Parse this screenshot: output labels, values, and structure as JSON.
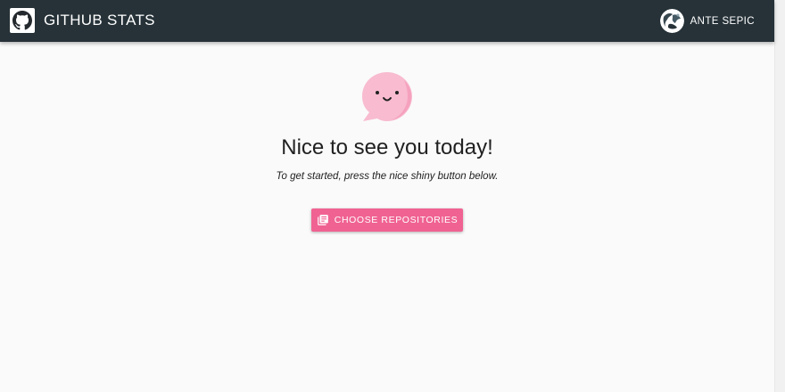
{
  "app": {
    "title": "GITHUB STATS",
    "logo_icon": "github-octocat-icon"
  },
  "user": {
    "name": "ANTE SEPIC",
    "avatar_icon": "avatar-globe-icon"
  },
  "main": {
    "illustration_icon": "smiling-chat-bubble-icon",
    "greeting": "Nice to see you today!",
    "subtitle": "To get started, press the nice shiny button below.",
    "cta": {
      "label": "CHOOSE REPOSITORIES",
      "icon": "library-books-icon"
    }
  },
  "colors": {
    "topbar": "#263238",
    "accent": "#f06292",
    "bubble": "#f8bbd0",
    "background": "#fafafa"
  }
}
